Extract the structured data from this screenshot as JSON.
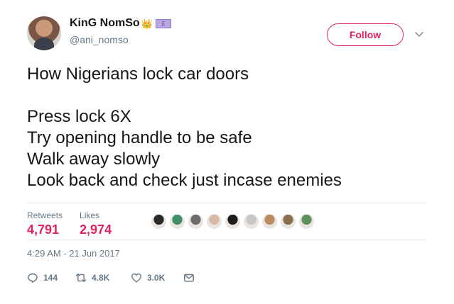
{
  "user": {
    "display_name": "KinG NomSo",
    "handle": "@ani_nomso",
    "name_emojis": [
      "crown-emoji",
      "pound-banknote-emoji"
    ]
  },
  "follow_label": "Follow",
  "tweet_text": "How Nigerians lock car doors\n\nPress lock 6X\nTry opening handle to be safe\nWalk away slowly\nLook back and check just incase enemies",
  "stats": {
    "retweets_label": "Retweets",
    "retweets_value": "4,791",
    "likes_label": "Likes",
    "likes_value": "2,974"
  },
  "liker_avatars": [
    "#2a2a2a",
    "#3f8f6a",
    "#6c6c6c",
    "#d9b9a6",
    "#1c1c1c",
    "#c7c7c7",
    "#b98b5e",
    "#8a6f4f",
    "#5e8f5e"
  ],
  "timestamp": "4:29 AM - 21 Jun 2017",
  "actions": {
    "reply_count": "144",
    "retweet_count": "4.8K",
    "like_count": "3.0K"
  },
  "colors": {
    "accent": "#e0245e",
    "muted": "#657786",
    "text": "#14171a"
  }
}
